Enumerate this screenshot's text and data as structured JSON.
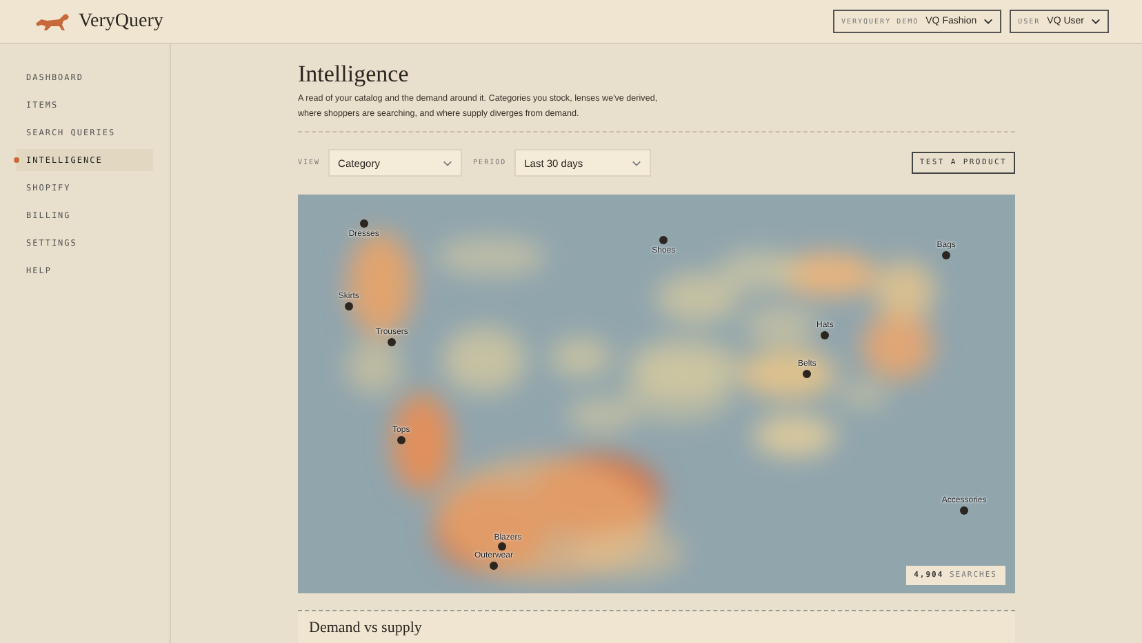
{
  "header": {
    "brand": "VeryQuery",
    "selectors": [
      {
        "label": "VERYQUERY DEMO",
        "value": "VQ Fashion"
      },
      {
        "label": "USER",
        "value": "VQ User"
      }
    ]
  },
  "sidebar": {
    "items": [
      {
        "label": "DASHBOARD",
        "selected": false
      },
      {
        "label": "ITEMS",
        "selected": false
      },
      {
        "label": "SEARCH QUERIES",
        "selected": false
      },
      {
        "label": "INTELLIGENCE",
        "selected": true
      },
      {
        "label": "SHOPIFY",
        "selected": false
      },
      {
        "label": "BILLING",
        "selected": false
      },
      {
        "label": "SETTINGS",
        "selected": false
      },
      {
        "label": "HELP",
        "selected": false
      }
    ]
  },
  "page": {
    "title": "Intelligence",
    "description": "A read of your catalog and the demand around it. Categories you stock, lenses we've derived, where shoppers are searching, and where supply diverges from demand."
  },
  "filters": [
    {
      "label": "VIEW",
      "value": "Category"
    },
    {
      "label": "PERIOD",
      "value": "Last 30 days"
    }
  ],
  "test_button": "TEST A PRODUCT",
  "map": {
    "pins": [
      "Dresses",
      "Shoes",
      "Bags",
      "Skirts",
      "Trousers",
      "Hats",
      "Belts",
      "Tops",
      "Blazers",
      "Outerwear",
      "Accessories"
    ],
    "count": "**4,904** SEARCHES"
  },
  "next_section": {
    "title": "Demand vs supply"
  }
}
